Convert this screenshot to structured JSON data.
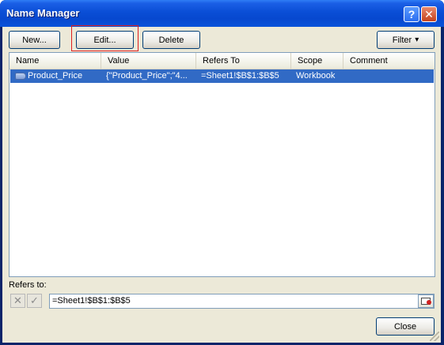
{
  "window": {
    "title": "Name Manager",
    "help_glyph": "?",
    "close_glyph": "✕"
  },
  "toolbar": {
    "new_label": "New...",
    "edit_label": "Edit...",
    "delete_label": "Delete",
    "filter_label": "Filter",
    "filter_arrow": "▾"
  },
  "list": {
    "columns": [
      "Name",
      "Value",
      "Refers To",
      "Scope",
      "Comment"
    ],
    "rows": [
      {
        "name": "Product_Price",
        "value": "{\"Product_Price\";\"4...",
        "refers_to": "=Sheet1!$B$1:$B$5",
        "scope": "Workbook",
        "comment": "",
        "selected": true
      }
    ]
  },
  "refers": {
    "label": "Refers to:",
    "value": "=Sheet1!$B$1:$B$5",
    "cancel_glyph": "✕",
    "accept_glyph": "✓"
  },
  "footer": {
    "close_label": "Close"
  },
  "colors": {
    "titlebar": "#0a4ed6",
    "selection": "#316ac5",
    "dialog_bg": "#ece9d8",
    "focus_highlight": "#e02020"
  }
}
